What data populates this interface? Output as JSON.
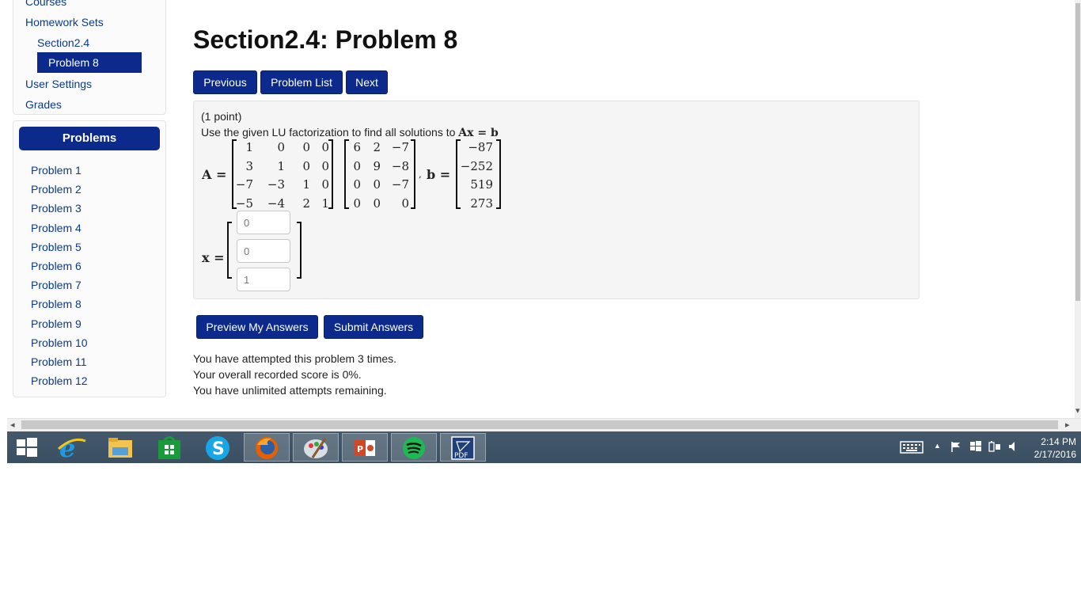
{
  "sidebar": {
    "nav": {
      "courses": "Courses",
      "homework_sets": "Homework Sets",
      "section": "Section2.4",
      "problem": "Problem 8",
      "user_settings": "User Settings",
      "grades": "Grades"
    },
    "problems_header": "Problems",
    "problems": [
      "Problem 1",
      "Problem 2",
      "Problem 3",
      "Problem 4",
      "Problem 5",
      "Problem 6",
      "Problem 7",
      "Problem 8",
      "Problem 9",
      "Problem 10",
      "Problem 11",
      "Problem 12"
    ]
  },
  "main": {
    "title": "Section2.4: Problem 8",
    "buttons": {
      "previous": "Previous",
      "problem_list": "Problem List",
      "next": "Next"
    },
    "points": "(1 point)",
    "instruction": "Use the given LU factorization to find all solutions to",
    "instruction_math": "Ax = b",
    "label_A": "A =",
    "label_b": "b =",
    "label_x": "x =",
    "comma": ",",
    "matrix_L": [
      [
        "1",
        "0",
        "0",
        "0"
      ],
      [
        "3",
        "1",
        "0",
        "0"
      ],
      [
        "−7",
        "−3",
        "1",
        "0"
      ],
      [
        "−5",
        "−4",
        "2",
        "1"
      ]
    ],
    "matrix_U": [
      [
        "6",
        "2",
        "−7"
      ],
      [
        "0",
        "9",
        "−8"
      ],
      [
        "0",
        "0",
        "−7"
      ],
      [
        "0",
        "0",
        "0"
      ]
    ],
    "vector_b": [
      "−87",
      "−252",
      "519",
      "273"
    ],
    "answers": [
      "0",
      "0",
      "1"
    ],
    "actions": {
      "preview": "Preview My Answers",
      "submit": "Submit Answers"
    },
    "status": [
      "You have attempted this problem 3 times.",
      "Your overall recorded score is 0%.",
      "You have unlimited attempts remaining."
    ]
  },
  "taskbar": {
    "apps": [
      "windows-start-icon",
      "internet-explorer-icon",
      "file-explorer-icon",
      "store-icon",
      "skype-icon",
      "firefox-icon",
      "paint-icon",
      "powerpoint-icon",
      "spotify-icon",
      "pdf-icon"
    ],
    "time": "2:14 PM",
    "date": "2/17/2016"
  },
  "colors": {
    "accent": "#0b2a8c",
    "link": "#0b3a8c",
    "taskbar": "#3f5466"
  }
}
